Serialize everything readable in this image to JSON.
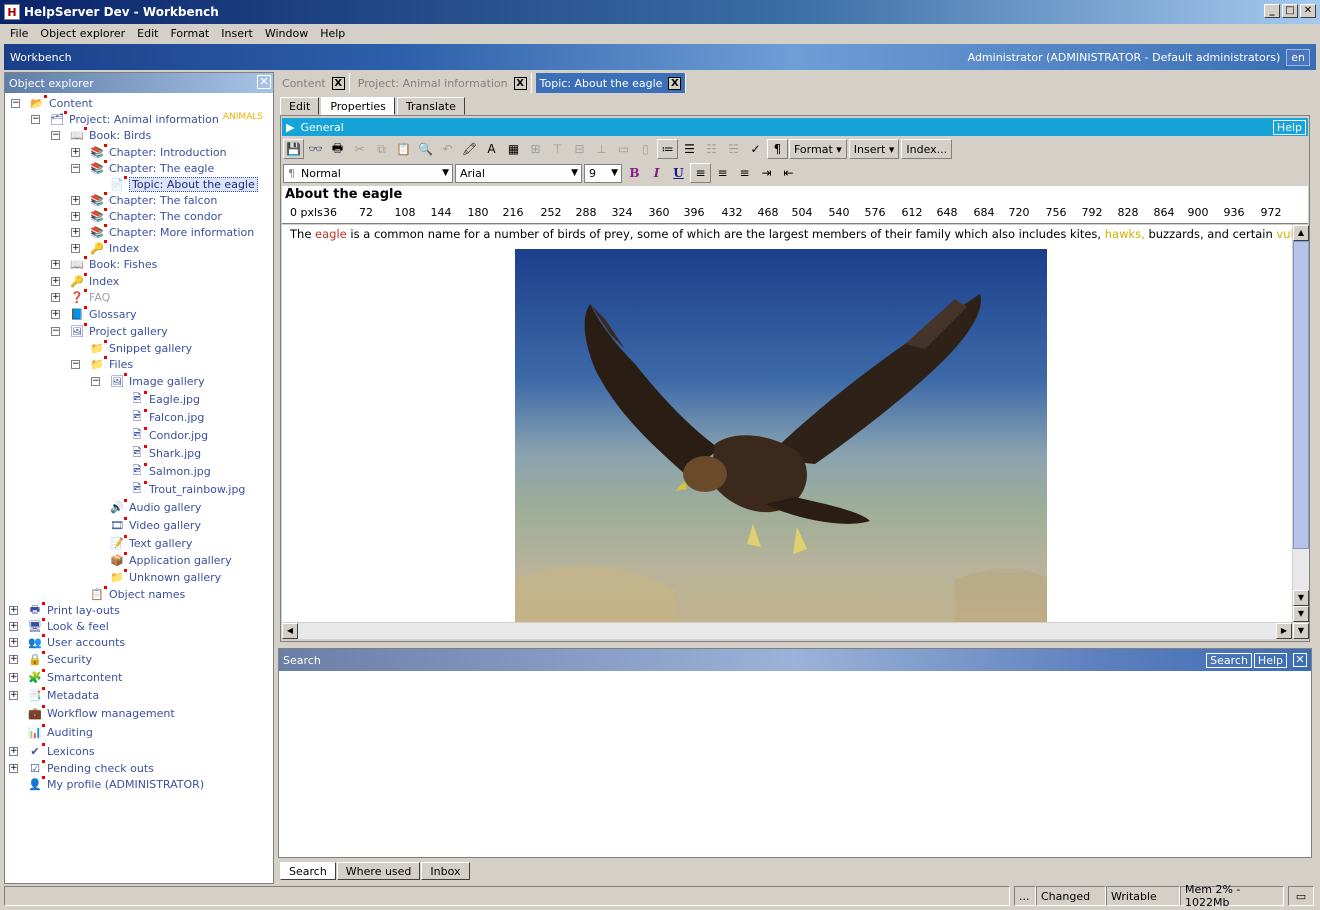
{
  "window": {
    "title": "HelpServer Dev - Workbench",
    "app_icon": "H"
  },
  "menu": [
    "File",
    "Object explorer",
    "Edit",
    "Format",
    "Insert",
    "Window",
    "Help"
  ],
  "workbench": {
    "title": "Workbench",
    "user": "Administrator (ADMINISTRATOR - Default administrators)",
    "lang": "en"
  },
  "explorer": {
    "title": "Object explorer",
    "nodes": [
      {
        "label": "Content",
        "icon": "content-folder-icon"
      },
      {
        "label": "Project: Animal information",
        "badge": "ANIMALS",
        "icon": "project-icon"
      },
      {
        "label": "Book: Birds",
        "icon": "book-icon"
      },
      {
        "label": "Chapter: Introduction",
        "icon": "chapter-icon"
      },
      {
        "label": "Chapter: The eagle",
        "icon": "chapter-icon"
      },
      {
        "label": "Topic: About the eagle",
        "icon": "topic-icon"
      },
      {
        "label": "Chapter: The falcon",
        "icon": "chapter-icon"
      },
      {
        "label": "Chapter: The condor",
        "icon": "chapter-icon"
      },
      {
        "label": "Chapter: More information",
        "icon": "chapter-icon"
      },
      {
        "label": "Index",
        "icon": "index-icon"
      },
      {
        "label": "Book: Fishes",
        "icon": "book-icon"
      },
      {
        "label": "Index",
        "icon": "index-icon"
      },
      {
        "label": "FAQ",
        "icon": "faq-icon"
      },
      {
        "label": "Glossary",
        "icon": "glossary-icon"
      },
      {
        "label": "Project gallery",
        "icon": "gallery-icon"
      },
      {
        "label": "Snippet gallery",
        "icon": "folder-icon"
      },
      {
        "label": "Files",
        "icon": "folder-icon"
      },
      {
        "label": "Image gallery",
        "icon": "image-gallery-icon"
      },
      {
        "label": "Eagle.jpg",
        "icon": "image-file-icon"
      },
      {
        "label": "Falcon.jpg",
        "icon": "image-file-icon"
      },
      {
        "label": "Condor.jpg",
        "icon": "image-file-icon"
      },
      {
        "label": "Shark.jpg",
        "icon": "image-file-icon"
      },
      {
        "label": "Salmon.jpg",
        "icon": "image-file-icon"
      },
      {
        "label": "Trout_rainbow.jpg",
        "icon": "image-file-icon"
      },
      {
        "label": "Audio gallery",
        "icon": "audio-gallery-icon"
      },
      {
        "label": "Video gallery",
        "icon": "video-gallery-icon"
      },
      {
        "label": "Text gallery",
        "icon": "text-gallery-icon"
      },
      {
        "label": "Application gallery",
        "icon": "application-gallery-icon"
      },
      {
        "label": "Unknown gallery",
        "icon": "unknown-gallery-icon"
      },
      {
        "label": "Object names",
        "icon": "object-names-icon"
      },
      {
        "label": "Print lay-outs",
        "icon": "printer-icon"
      },
      {
        "label": "Look & feel",
        "icon": "monitor-icon"
      },
      {
        "label": "User accounts",
        "icon": "users-icon"
      },
      {
        "label": "Security",
        "icon": "lock-icon"
      },
      {
        "label": "Smartcontent",
        "icon": "smartcontent-icon"
      },
      {
        "label": "Metadata",
        "icon": "metadata-icon"
      },
      {
        "label": "Workflow management",
        "icon": "workflow-icon"
      },
      {
        "label": "Auditing",
        "icon": "chart-icon"
      },
      {
        "label": "Lexicons",
        "icon": "spellcheck-icon"
      },
      {
        "label": "Pending check outs",
        "icon": "checkout-icon"
      },
      {
        "label": "My profile (ADMINISTRATOR)",
        "icon": "user-icon"
      }
    ]
  },
  "doc_tabs": [
    "Content",
    "Project: Animal information",
    "Topic: About the eagle"
  ],
  "sub_tabs": [
    "Edit",
    "Properties",
    "Translate"
  ],
  "general": {
    "title": "General",
    "help": "Help"
  },
  "toolbar": {
    "format_label": "Format",
    "insert_label": "Insert",
    "index_label": "Index...",
    "style_value": "Normal",
    "font_value": "Arial",
    "size_value": "9",
    "bold": "B",
    "italic": "I",
    "underline": "U"
  },
  "document": {
    "title": "About the eagle",
    "ruler": [
      "0 pxls",
      "36",
      "72",
      "108",
      "144",
      "180",
      "216",
      "252",
      "288",
      "324",
      "360",
      "396",
      "432",
      "468",
      "504",
      "540",
      "576",
      "612",
      "648",
      "684",
      "720",
      "756",
      "792",
      "828",
      "864",
      "900",
      "936",
      "972"
    ],
    "text": {
      "t1": "The ",
      "w1": "eagle",
      "t2": " is a common name for a number of birds of prey, some of which are the largest members of their family which also includes kites, ",
      "w2": "hawks,",
      "t3": " buzzards, and certain ",
      "w3": "vultures."
    }
  },
  "search_panel": {
    "title": "Search",
    "search_btn": "Search",
    "help_btn": "Help"
  },
  "bottom_tabs": [
    "Search",
    "Where used",
    "Inbox"
  ],
  "status": {
    "dots": "...",
    "changed": "Changed",
    "writable": "Writable",
    "memory": "Mem 2% - 1022Mb"
  },
  "colors": {
    "accent_tab": "#3b6fb8",
    "general_bar": "#16a4d8",
    "tree_text": "#3b4fa0",
    "link_red": "#c03020",
    "link_yellow": "#d0b000"
  }
}
